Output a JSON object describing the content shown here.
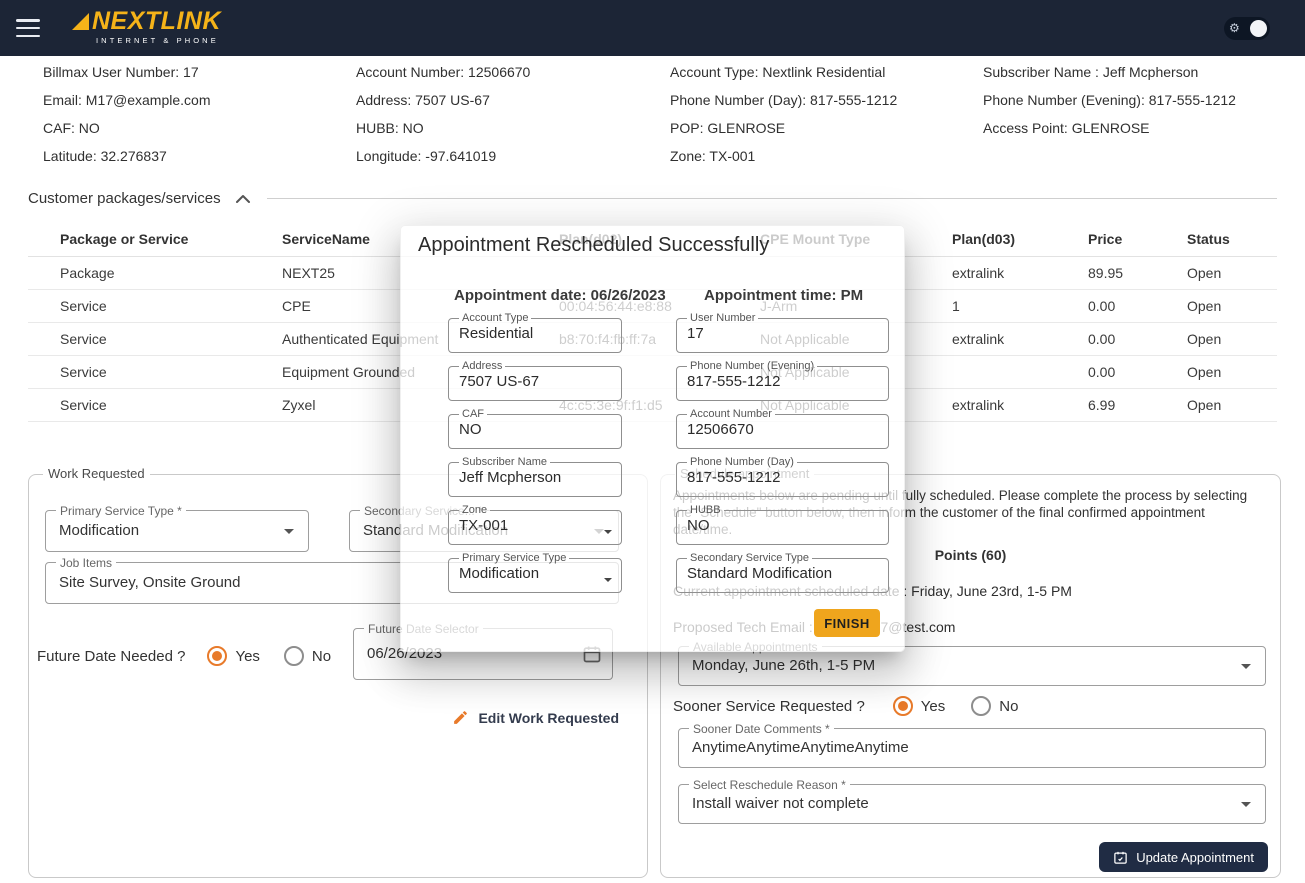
{
  "colors": {
    "header_bg": "#1c2536",
    "brand_gold": "#f5b319",
    "accent_orange": "#e87a2a",
    "button_navy": "#202c44",
    "finish_amber": "#efa51d"
  },
  "header": {
    "brand": "NEXTLINK",
    "tagline": "INTERNET & PHONE"
  },
  "icons": {
    "menu_icon": "hamburger",
    "theme_toggle_icon": "gear",
    "collapse_icon": "chevron-up",
    "select_icon": "caret-down",
    "date_icon": "calendar",
    "edit_icon": "pencil",
    "update_icon": "calendar-check"
  },
  "customer_info": {
    "col1": [
      "Billmax User Number: 17",
      "Email: M17@example.com",
      "CAF: NO",
      "Latitude: 32.276837"
    ],
    "col2": [
      "Account Number: 12506670",
      "Address: 7507 US-67",
      "HUBB: NO",
      "Longitude: -97.641019"
    ],
    "col3": [
      "Account Type: Nextlink Residential",
      "Phone Number (Day): 817-555-1212",
      "POP: GLENROSE",
      "Zone: TX-001"
    ],
    "col4": [
      "Subscriber Name : Jeff Mcpherson",
      "Phone Number (Evening): 817-555-1212",
      "Access Point: GLENROSE"
    ]
  },
  "packages": {
    "title": "Customer packages/services",
    "table": {
      "headers": [
        "Package or Service",
        "ServiceName",
        "Plan(d02)",
        "CPE Mount Type",
        "Plan(d03)",
        "Price",
        "Status"
      ],
      "rows": [
        [
          "Package",
          "NEXT25",
          "",
          "",
          "extralink",
          "89.95",
          "Open"
        ],
        [
          "Service",
          "CPE",
          "00:04:56:44:e8:88",
          "J-Arm",
          "1",
          "0.00",
          "Open"
        ],
        [
          "Service",
          "Authenticated Equipment",
          "b8:70:f4:fb:ff:7a",
          "Not Applicable",
          "extralink",
          "0.00",
          "Open"
        ],
        [
          "Service",
          "Equipment Grounded",
          "",
          "Not Applicable",
          "",
          "0.00",
          "Open"
        ],
        [
          "Service",
          "Zyxel",
          "4c:c5:3e:9f:f1:d5",
          "Not Applicable",
          "extralink",
          "6.99",
          "Open"
        ]
      ]
    }
  },
  "work_requested": {
    "legend": "Work Requested",
    "primary_service_type": {
      "label": "Primary Service Type *",
      "value": "Modification"
    },
    "secondary_service_type": {
      "label": "Secondary Service... *",
      "value": "Standard Modification"
    },
    "job_items": {
      "label": "Job Items",
      "value": "Site Survey, Onsite Ground"
    },
    "future_date_needed": {
      "label": "Future Date Needed ?",
      "options": [
        "Yes",
        "No"
      ],
      "selected": "Yes"
    },
    "future_date_selector": {
      "label": "Future Date Selector",
      "value": "06/26/2023"
    },
    "edit_button_label": "Edit Work Requested"
  },
  "schedule": {
    "legend": "Schedule appointment",
    "notice": "Appointments below are pending until fully scheduled. Please complete the process by selecting the \"Schedule\" button below, then inform the customer of the final confirmed appointment date/time.",
    "points": "Points (60)",
    "current_appointment": "Current appointment scheduled date : Friday, June 23rd, 1-5 PM",
    "proposed_tech_email": "Proposed Tech Email : wtest89787@test.com",
    "available_appointments": {
      "label": "Available Appointments",
      "value": "Monday, June 26th, 1-5 PM"
    },
    "sooner_service_requested": {
      "label": "Sooner Service Requested ?",
      "options": [
        "Yes",
        "No"
      ],
      "selected": "Yes"
    },
    "sooner_date_comments": {
      "label": "Sooner Date Comments *",
      "value": "AnytimeAnytimeAnytimeAnytime"
    },
    "reschedule_reason": {
      "label": "Select Reschedule Reason *",
      "value": "Install waiver not complete"
    },
    "update_button_label": "Update Appointment"
  },
  "modal": {
    "title": "Appointment Rescheduled Successfully",
    "appointment_date": "Appointment date: 06/26/2023",
    "appointment_time": "Appointment time: PM",
    "fields": [
      {
        "label": "Account Type",
        "value": "Residential"
      },
      {
        "label": "User Number",
        "value": "17"
      },
      {
        "label": "Address",
        "value": "7507 US-67"
      },
      {
        "label": "Phone Number (Evening)",
        "value": "817-555-1212"
      },
      {
        "label": "CAF",
        "value": "NO"
      },
      {
        "label": "Account Number",
        "value": "12506670"
      },
      {
        "label": "Subscriber Name",
        "value": "Jeff Mcpherson"
      },
      {
        "label": "Phone Number (Day)",
        "value": "817-555-1212"
      },
      {
        "label": "Zone",
        "value": "TX-001"
      },
      {
        "label": "HUBB",
        "value": "NO"
      },
      {
        "label": "Primary Service Type",
        "value": "Modification"
      },
      {
        "label": "Secondary Service Type",
        "value": "Standard Modification"
      }
    ],
    "finish_button_label": "FINISH"
  }
}
